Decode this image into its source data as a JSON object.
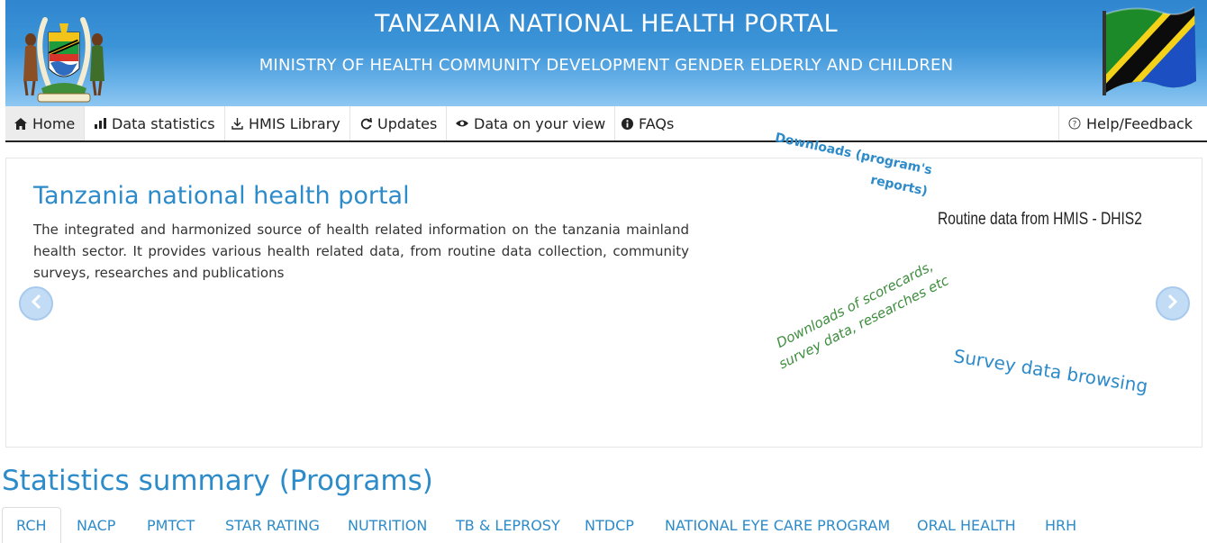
{
  "header": {
    "title": "TANZANIA NATIONAL HEALTH PORTAL",
    "subtitle": "MINISTRY OF HEALTH COMMUNITY DEVELOPMENT GENDER ELDERLY AND CHILDREN",
    "emblem_icon": "coat-of-arms-icon",
    "flag_icon": "tanzania-flag-icon",
    "colors": {
      "banner_top": "#2f86cf",
      "banner_bottom": "#8ec7f1"
    }
  },
  "nav": {
    "items": [
      {
        "label": "Home",
        "icon": "home-icon"
      },
      {
        "label": "Data statistics",
        "icon": "bar-chart-icon"
      },
      {
        "label": "HMIS Library",
        "icon": "download-icon"
      },
      {
        "label": "Updates",
        "icon": "refresh-icon"
      },
      {
        "label": "Data on your view",
        "icon": "eye-icon"
      },
      {
        "label": "FAQs",
        "icon": "info-icon"
      }
    ],
    "help": {
      "label": "Help/Feedback",
      "icon": "help-circle-icon"
    }
  },
  "carousel": {
    "title": "Tanzania national health portal",
    "text": "The integrated and harmonized source of health related information on the tanzania mainland health sector. It provides various health related data, from routine data collection, community surveys, researches and publications",
    "prev_icon": "chevron-left-icon",
    "next_icon": "chevron-right-icon",
    "word_cloud": {
      "downloads_programs": "Downloads (program's reports)",
      "routine_data": "Routine data from HMIS - DHIS2",
      "downloads_scorecards": "Downloads of scorecards, survey data, researches etc",
      "survey_browsing": "Survey data browsing"
    }
  },
  "statistics": {
    "title": "Statistics summary (Programs)",
    "tabs": [
      "RCH",
      "NACP",
      "PMTCT",
      "STAR RATING",
      "NUTRITION",
      "TB & LEPROSY",
      "NTDCP",
      "NATIONAL EYE CARE PROGRAM",
      "ORAL HEALTH",
      "HRH"
    ],
    "active_tab": "RCH"
  }
}
